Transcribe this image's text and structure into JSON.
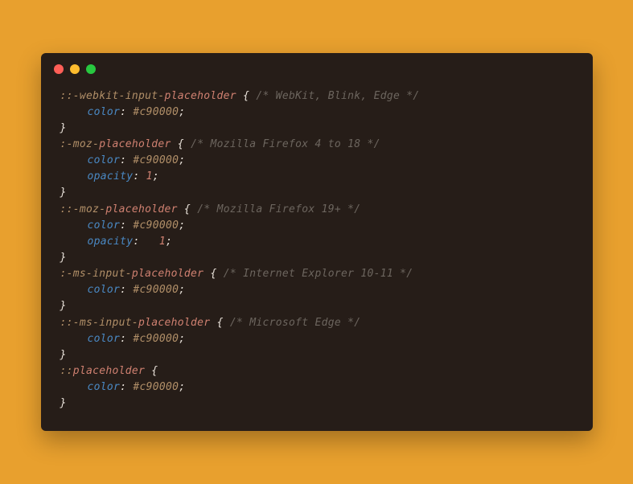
{
  "code": {
    "l1_prefix": "::-webkit-input-",
    "l1_selector": "placeholder",
    "l1_brace": " {",
    "l1_comment": " /* WebKit, Blink, Edge */",
    "l2_prop": "color",
    "l2_colon": ": ",
    "l2_value": "#c90000",
    "l2_semi": ";",
    "l3_brace": "}",
    "l4_prefix": ":-moz-",
    "l4_selector": "placeholder",
    "l4_brace": " {",
    "l4_comment": " /* Mozilla Firefox 4 to 18 */",
    "l5_prop": "color",
    "l5_colon": ": ",
    "l5_value": "#c90000",
    "l5_semi": ";",
    "l6_prop": "opacity",
    "l6_colon": ": ",
    "l6_value": "1",
    "l6_semi": ";",
    "l7_brace": "}",
    "l8_prefix": "::-moz-",
    "l8_selector": "placeholder",
    "l8_brace": " {",
    "l8_comment": " /* Mozilla Firefox 19+ */",
    "l9_prop": "color",
    "l9_colon": ": ",
    "l9_value": "#c90000",
    "l9_semi": ";",
    "l10_prop": "opacity",
    "l10_colon": ":   ",
    "l10_value": "1",
    "l10_semi": ";",
    "l11_brace": "}",
    "l12_prefix": ":-ms-input-",
    "l12_selector": "placeholder",
    "l12_brace": " {",
    "l12_comment": " /* Internet Explorer 10-11 */",
    "l13_prop": "color",
    "l13_colon": ": ",
    "l13_value": "#c90000",
    "l13_semi": ";",
    "l14_brace": "}",
    "l15_prefix": "::-ms-input-",
    "l15_selector": "placeholder",
    "l15_brace": " {",
    "l15_comment": " /* Microsoft Edge */",
    "l16_prop": "color",
    "l16_colon": ": ",
    "l16_value": "#c90000",
    "l16_semi": ";",
    "l17_brace": "}",
    "blank": "",
    "l18_prefix": "::",
    "l18_selector": "placeholder",
    "l18_brace": " {",
    "l19_prop": "color",
    "l19_colon": ": ",
    "l19_value": "#c90000",
    "l19_semi": ";",
    "l20_brace": "}"
  }
}
